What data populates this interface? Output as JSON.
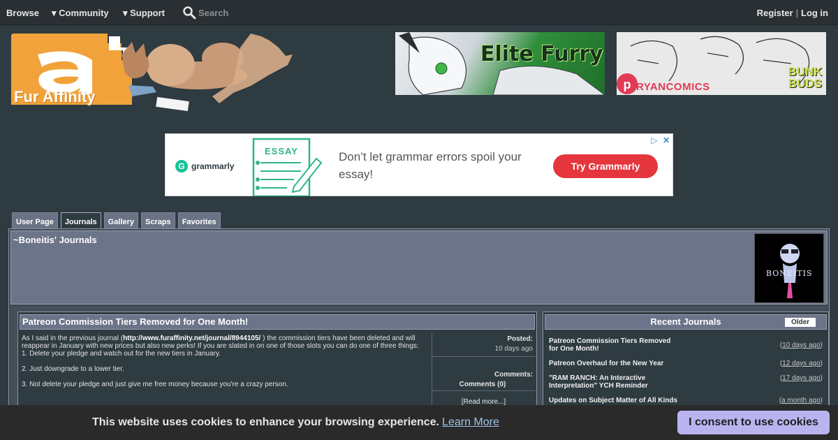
{
  "nav": {
    "browse": "Browse",
    "community": "▾ Community",
    "support": "▾ Support",
    "search_placeholder": "Search",
    "register": "Register",
    "separator": "|",
    "login": "Log in"
  },
  "header": {
    "logo_text": "Fur Affinity",
    "banner1_text": "Elite Furry",
    "banner2_text": "RYANCOMICS",
    "banner2_sub": "BUNK BUDS"
  },
  "ad": {
    "brand": "grammarly",
    "image_label": "ESSAY",
    "headline": "Don’t let grammar errors spoil your essay!",
    "cta": "Try Grammarly"
  },
  "tabs": [
    "User Page",
    "Journals",
    "Gallery",
    "Scraps",
    "Favorites"
  ],
  "profile": {
    "title": "~Boneitis' Journals",
    "avatar_text": "BONEITIS"
  },
  "journal": {
    "title": "Patreon Commission Tiers Removed for One Month!",
    "intro_pre": "As I said in the previous journal (",
    "intro_link": "http://www.furaffinity.net/journal/8944105/",
    "intro_post": " ) the commission tiers have been deleted and will reappear in January with new prices but also new perks! If you are slated in on one of those slots you can do one of three things:",
    "option1": "1. Delete your pledge and watch out for the new tiers in January.",
    "option2": "2. Just downgrade to a lower tier.",
    "option3": "3. Not delete your pledge and just give me free money because you're a crazy person.",
    "posted_label": "Posted:",
    "posted_value": "10 days ago",
    "comments_label": "Comments:",
    "comments_value": "Comments (0)",
    "read_more": "[Read more...]"
  },
  "recent": {
    "title": "Recent Journals",
    "older": "Older",
    "items": [
      {
        "title": "Patreon Commission Tiers Removed for One Month!",
        "date": "10 days ago"
      },
      {
        "title": "Patreon Overhaul for the New Year",
        "date": "12 days ago"
      },
      {
        "title": "\"RAM RANCH: An Interactive Interpretation\" YCH Reminder",
        "date": "17 days ago"
      },
      {
        "title": "Updates on Subject Matter of All Kinds",
        "date": "a month ago"
      }
    ]
  },
  "cookie": {
    "message": "This website uses cookies to enhance your browsing experience.",
    "learn_more": "Learn More",
    "consent": "I consent to use cookies"
  },
  "colors": {
    "page_bg": "#2e3b41",
    "header_bar": "#6c7489",
    "consent_button": "#b9b4f0",
    "ad_cta": "#e5363d"
  }
}
